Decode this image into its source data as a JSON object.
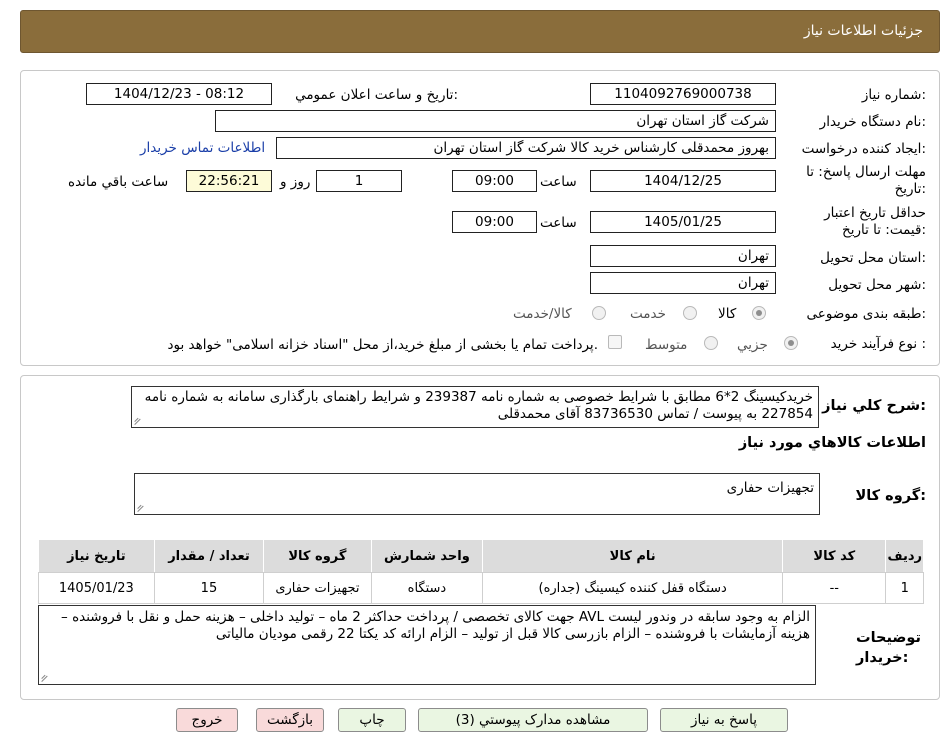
{
  "header": {
    "title": "جزئیات اطلاعات نیاز"
  },
  "form": {
    "need_number_label": "شماره نیاز:",
    "need_number": "1104092769000738",
    "announce_label": "تاریخ و ساعت اعلان عمومي:",
    "announce_value": "1404/12/23 - 08:12",
    "buyer_org_label": "نام دستگاه خريدار:",
    "buyer_org": "شرکت گاز استان تهران",
    "creator_label": "ايجاد کننده درخواست:",
    "creator": "بهروز محمدقلی کارشناس خرید کالا شرکت گاز استان تهران",
    "contact_link": "اطلاعات تماس خريدار",
    "deadline_label": "مهلت ارسال پاسخ: تا تاريخ:",
    "deadline_date": "1404/12/25",
    "time_label": "ساعت",
    "deadline_time": "09:00",
    "days": "1",
    "days_label": "روز و",
    "remaining_time": "22:56:21",
    "remaining_label": "ساعت باقي مانده",
    "validity_label": "حداقل تاريخ اعتبار قيمت: تا تاريخ:",
    "validity_date": "1405/01/25",
    "validity_time_label": "ساعت",
    "validity_time": "09:00",
    "province_label": "استان محل تحويل:",
    "province": "تهران",
    "city_label": "شهر محل تحويل:",
    "city": "تهران",
    "category_label": "طبقه بندی موضوعی:",
    "category_options": [
      "کالا",
      "خدمت",
      "کالا/خدمت"
    ],
    "process_label": "نوع فرآيند خريد :",
    "process_options": [
      "جزيي",
      "متوسط"
    ],
    "process_note": "پرداخت تمام يا بخشی از مبلغ خريد،از محل \"اسناد خزانه اسلامی\" خواهد بود."
  },
  "description": {
    "label": "شرح کلي نياز:",
    "text": "خریدکیسینگ 2*6 مطابق با شرایط خصوصی به شماره نامه 239387 و شرایط راهنمای بارگذاری سامانه به شماره نامه 227854 به پیوست  / تماس 83736530 آقای محمدقلی"
  },
  "goods": {
    "section_title": "اطلاعات کالاهاي مورد نياز",
    "group_label": "گروه کالا:",
    "group_value": "تجهیزات حفاری"
  },
  "table": {
    "headers": [
      "رديف",
      "کد کالا",
      "نام کالا",
      "واحد شمارش",
      "گروه کالا",
      "تعداد / مقدار",
      "تاريخ نياز"
    ],
    "rows": [
      [
        "1",
        "--",
        "دستگاه قفل کننده کیسینگ (جداره)",
        "دستگاه",
        "تجهیزات حفاری",
        "15",
        "1405/01/23"
      ]
    ]
  },
  "notes": {
    "label": "توضيحات خريدار:",
    "text": "الزام به وجود سابقه در وندور لیست AVL جهت کالای تخصصی / پرداخت حداکثر 2 ماه – تولید  داخلی – هزینه حمل و نقل با فروشنده – هزینه آزمایشات با فروشنده – الزام بازرسی کالا قبل از تولید – الزام ارائه  کد یکتا  22 رقمی مودیان مالیاتی"
  },
  "buttons": {
    "reply": "پاسخ به نياز",
    "attachments": "مشاهده مدارک پيوستي (3)",
    "print": "چاپ",
    "back": "بازگشت",
    "exit": "خروج"
  },
  "watermark": {
    "text": "AriaTender.neT"
  },
  "colors": {
    "header": "#8a6d3b",
    "highlight": "#fdfbd8",
    "link": "#1a3ea8",
    "button_green": "#eaf6e2",
    "button_red": "#f9dada"
  }
}
